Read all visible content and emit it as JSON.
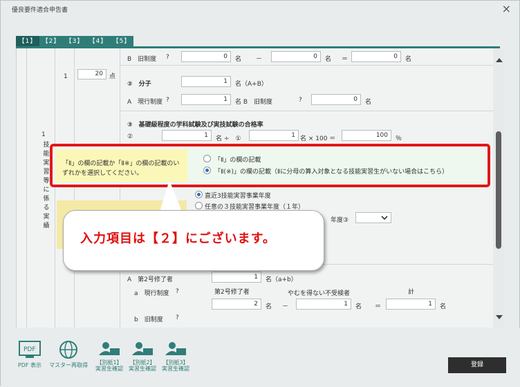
{
  "window": {
    "title": "優良要件適合申告書",
    "close_label": "×"
  },
  "tabs": [
    "【1】",
    "【2】",
    "【3】",
    "【4】",
    "【5】"
  ],
  "left": {
    "num": "1",
    "vertical_text": "技能実習等に係る実績",
    "row_num": "1",
    "points": "20",
    "points_unit": "点"
  },
  "rows": {
    "b_old_label": "B　旧制度",
    "q": "?",
    "b_old_val1": "0",
    "b_old_unit1": "名",
    "minus": "－",
    "b_old_val2": "0",
    "b_old_unit2": "名",
    "eq": "＝",
    "b_old_val3": "0",
    "b_old_unit3": "名",
    "numerator_title": "②　分子",
    "numerator_val": "1",
    "numerator_unit": "名（A+B）",
    "a_cur_label": "A　現行制度",
    "a_cur_val": "1",
    "a_cur_unit": "名 B　旧制度",
    "b_val": "0",
    "b_unit": "名",
    "pass_rate_title": "③　基礎級程度の学科試験及び実技試験の合格率",
    "pr_label": "②",
    "pr_val1": "1",
    "pr_op": "名 ÷　①",
    "pr_val2": "1",
    "pr_op2": "名 × 100 ＝",
    "pr_val3": "100",
    "pr_unit": "％"
  },
  "highlight": {
    "prompt": "「Ⅱ」の欄の記載か「Ⅱ※」の欄の記載のいずれかを選択してください。",
    "option1": "「Ⅱ」の欄の記載",
    "option2": "「Ⅱ(※)」の欄の記載（Ⅱに分母の算入対象となる技能実習生がいない場合はこちら）",
    "selected": 2
  },
  "behind": {
    "opt_a": "直近3技能実習事業年度",
    "opt_b": "任意の３技能実習事業年度（１年）",
    "year_label": "年度③",
    "small_label": "年",
    "a2_label": "A　第2号修了者",
    "a2_val": "1",
    "a2_unit": "名（a+b）",
    "a_cur2": "a　現行制度",
    "h_col1": "第2号修了者",
    "h_col2": "やむを得ない不受検者",
    "h_col3": "計",
    "r_val1": "2",
    "r_unit1": "名",
    "r_minus": "－",
    "r_val2": "1",
    "r_unit2": "名",
    "r_eq": "＝",
    "r_val3": "1",
    "r_unit3": "名",
    "b_old2": "b　旧制度"
  },
  "bubble": {
    "text": "入力項目は【２】にございます。"
  },
  "tools": [
    {
      "icon": "pdf-icon",
      "label": "PDF 表示"
    },
    {
      "icon": "globe-icon",
      "label": "マスター再取得"
    },
    {
      "icon": "person-icon",
      "label": "【別紙1】\n実習生確認"
    },
    {
      "icon": "person-icon",
      "label": "【別紙2】\n実習生確認"
    },
    {
      "icon": "person-icon",
      "label": "【別紙3】\n実習生確認"
    }
  ],
  "register_label": "登録",
  "colors": {
    "teal": "#2f7d79",
    "red": "#e11818",
    "yellow": "#fbf7b8"
  }
}
